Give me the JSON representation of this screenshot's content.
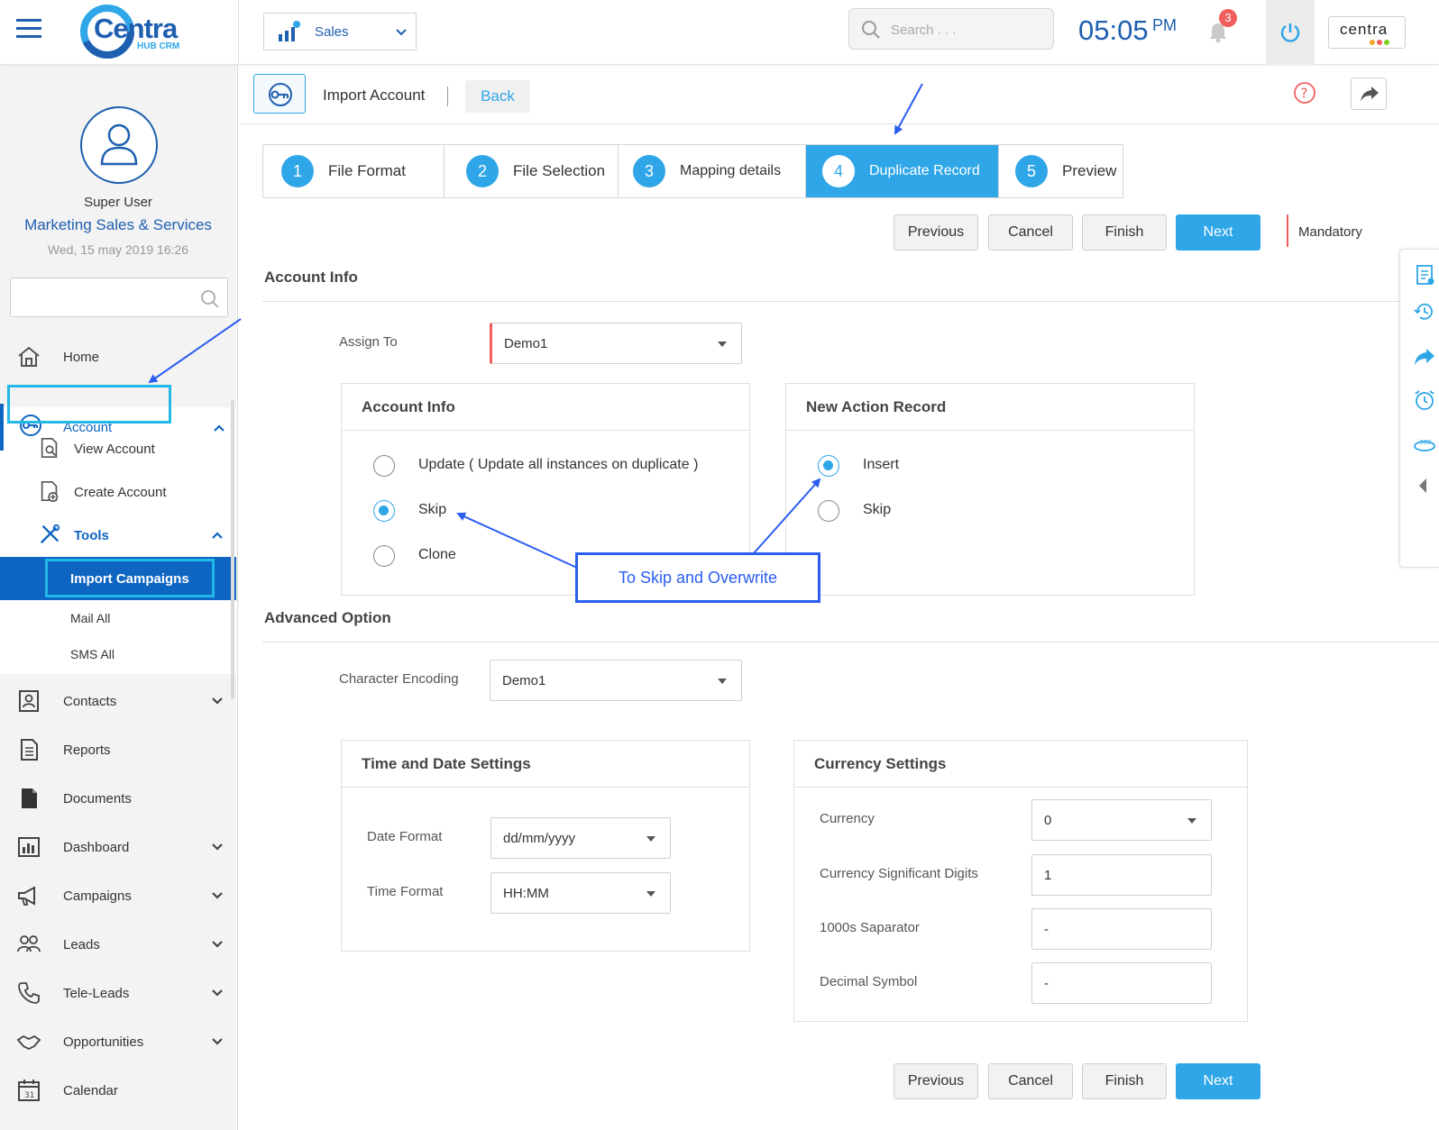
{
  "header": {
    "logo_text": "Centra",
    "logo_sub": "HUB CRM",
    "module_select": "Sales",
    "search_placeholder": "Search . . .",
    "time": "05:05",
    "time_suffix": "PM",
    "notification_count": "3",
    "brand_right": "centra"
  },
  "user": {
    "name": "Super User",
    "org": "Marketing Sales & Services",
    "datetime": "Wed, 15 may 2019 16:26"
  },
  "sidebar": {
    "items": [
      {
        "label": "Home"
      },
      {
        "label": "Account"
      },
      {
        "label": "View Account"
      },
      {
        "label": "Create Account"
      },
      {
        "label": "Tools"
      },
      {
        "label": "Import Campaigns"
      },
      {
        "label": "Mail All"
      },
      {
        "label": "SMS All"
      },
      {
        "label": "Contacts"
      },
      {
        "label": "Reports"
      },
      {
        "label": "Documents"
      },
      {
        "label": "Dashboard"
      },
      {
        "label": "Campaigns"
      },
      {
        "label": "Leads"
      },
      {
        "label": "Tele-Leads"
      },
      {
        "label": "Opportunities"
      },
      {
        "label": "Calendar"
      }
    ]
  },
  "page": {
    "title": "Import Account",
    "back_label": "Back"
  },
  "steps": [
    {
      "num": "1",
      "label": "File Format"
    },
    {
      "num": "2",
      "label": "File Selection"
    },
    {
      "num": "3",
      "label": "Mapping details"
    },
    {
      "num": "4",
      "label": "Duplicate Record"
    },
    {
      "num": "5",
      "label": "Preview"
    }
  ],
  "actions": {
    "previous": "Previous",
    "cancel": "Cancel",
    "finish": "Finish",
    "next": "Next",
    "mandatory": "Mandatory"
  },
  "account_info": {
    "section_title": "Account Info",
    "assign_to_label": "Assign To",
    "assign_to_value": "Demo1",
    "panel_title": "Account Info",
    "options": [
      {
        "label": "Update ( Update all instances on duplicate )",
        "selected": false
      },
      {
        "label": "Skip",
        "selected": true
      },
      {
        "label": "Clone",
        "selected": false
      }
    ]
  },
  "new_action": {
    "panel_title": "New Action Record",
    "options": [
      {
        "label": "Insert",
        "selected": true
      },
      {
        "label": "Skip",
        "selected": false
      }
    ]
  },
  "annotation": {
    "callout": "To Skip and Overwrite"
  },
  "advanced": {
    "section_title": "Advanced Option",
    "encoding_label": "Character Encoding",
    "encoding_value": "Demo1",
    "time_date": {
      "title": "Time and Date Settings",
      "date_format_label": "Date Format",
      "date_format_value": "dd/mm/yyyy",
      "time_format_label": "Time Format",
      "time_format_value": "HH:MM"
    },
    "currency": {
      "title": "Currency Settings",
      "currency_label": "Currency",
      "currency_value": "0",
      "digits_label": "Currency Significant Digits",
      "digits_value": "1",
      "thousands_label": "1000s Saparator",
      "thousands_value": "-",
      "decimal_label": "Decimal Symbol",
      "decimal_value": "-"
    }
  },
  "colors": {
    "accent": "#2ea6e8",
    "nav_active": "#0f66c2",
    "annotation": "#2a5df0",
    "highlight": "#22b8e8"
  },
  "icons": [
    "menu-icon",
    "sales-chart-icon",
    "search-icon",
    "bell-icon",
    "power-icon",
    "key-icon",
    "help-icon",
    "share-icon",
    "user-avatar-icon"
  ]
}
